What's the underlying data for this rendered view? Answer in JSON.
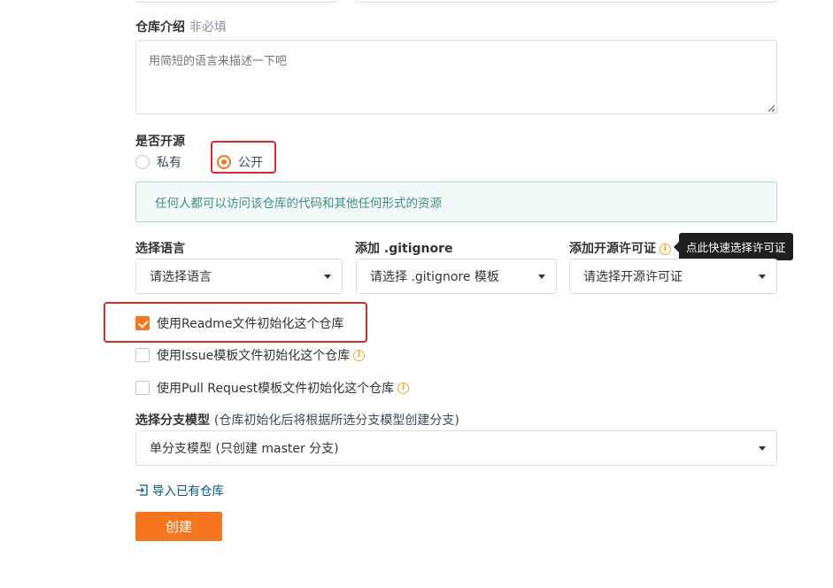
{
  "description_field": {
    "label": "仓库介绍",
    "optional_hint": "非必填",
    "placeholder": "用简短的语言来描述一下吧"
  },
  "visibility": {
    "label": "是否开源",
    "options": [
      "私有",
      "公开"
    ],
    "selected": "公开",
    "info_text": "任何人都可以访问该仓库的代码和其他任何形式的资源"
  },
  "language": {
    "label": "选择语言",
    "value": "请选择语言"
  },
  "gitignore": {
    "label": "添加 .gitignore",
    "value": "请选择 .gitignore 模板"
  },
  "license": {
    "label": "添加开源许可证",
    "value": "请选择开源许可证",
    "tooltip": "点此快速选择许可证"
  },
  "init_options": [
    {
      "label": "使用Readme文件初始化这个仓库",
      "checked": true
    },
    {
      "label": "使用Issue模板文件初始化这个仓库",
      "checked": false
    },
    {
      "label": "使用Pull Request模板文件初始化这个仓库",
      "checked": false
    }
  ],
  "branch_model": {
    "label": "选择分支模型",
    "hint": "(仓库初始化后将根据所选分支模型创建分支)",
    "value": "单分支模型 (只创建 master 分支)"
  },
  "import_link": "导入已有仓库",
  "create_button": "创建",
  "colors": {
    "accent": "#f5761f",
    "highlight": "#e0262d",
    "info_text": "#3d8c85",
    "link": "#005980"
  }
}
